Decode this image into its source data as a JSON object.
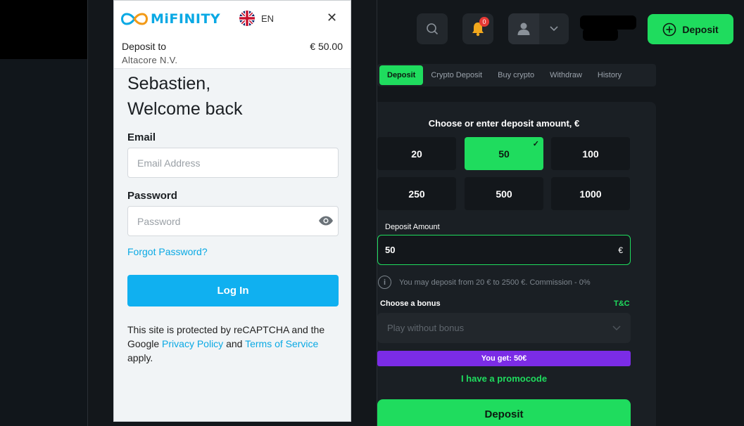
{
  "site": {
    "notification_count": "0",
    "deposit_button_label": "Deposit",
    "tabs": [
      "Deposit",
      "Crypto Deposit",
      "Buy crypto",
      "Withdraw",
      "History"
    ],
    "choose_title": "Choose or enter deposit amount, €",
    "amounts": [
      "20",
      "50",
      "100",
      "250",
      "500",
      "1000"
    ],
    "selected_amount": "50",
    "deposit_amount_label": "Deposit Amount",
    "deposit_amount_value": "50",
    "currency_symbol": "€",
    "limits_info": "You may deposit from 20 € to 2500 €. Commission - 0%",
    "bonus_label": "Choose a bonus",
    "tc_link": "T&C",
    "bonus_selected": "Play without bonus",
    "you_get": "You get: 50€",
    "promocode_link": "I have a promocode",
    "big_deposit_label": "Deposit",
    "accent_color": "#1fdc5e",
    "bonus_bar_color": "#7b2ce6"
  },
  "mifinity": {
    "logo_text": "MiFINITY",
    "language": "EN",
    "deposit_to_label": "Deposit to",
    "deposit_amount": "€ 50.00",
    "merchant": "Altacore N.V.",
    "greeting_line1": "Sebastien,",
    "greeting_line2": "Welcome back",
    "email_label": "Email",
    "email_placeholder": "Email Address",
    "password_label": "Password",
    "password_placeholder": "Password",
    "forgot_password": "Forgot Password?",
    "login_button": "Log In",
    "recaptcha_prefix": "This site is protected by reCAPTCHA and the Google",
    "privacy_link": "Privacy Policy",
    "and_text": "and",
    "terms_link": "Terms of Service",
    "apply_text": "apply.",
    "brand_color": "#0aa9e4"
  }
}
